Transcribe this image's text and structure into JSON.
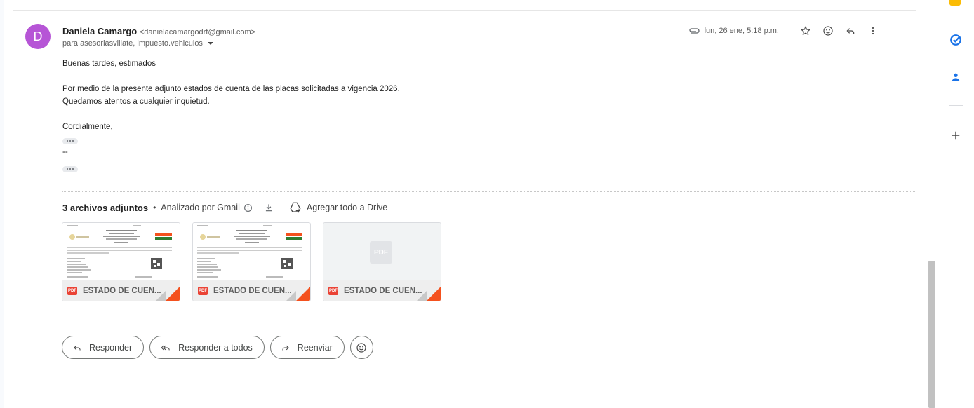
{
  "email": {
    "sender_initial": "D",
    "sender_name": "Daniela Camargo",
    "sender_email": "<danielacamargodrf@gmail.com>",
    "recipients": "para asesoriasvillate, impuesto.vehiculos",
    "date": "lun, 26 ene, 5:18 p.m.",
    "body": {
      "greeting": "Buenas tardes, estimados",
      "line1": "Por medio de la presente adjunto estados de cuenta de las placas solicitadas a vigencia 2026.",
      "line2": "Quedamos atentos a cualquier inquietud.",
      "closing": "Cordialmente,",
      "signature_sep": "--"
    }
  },
  "attachments": {
    "count_label": "3 archivos adjuntos",
    "separator": "•",
    "scanned_label": "Analizado por Gmail",
    "drive_label": "Agregar todo a Drive",
    "files": [
      {
        "name": "ESTADO DE CUEN...",
        "badge": "PDF",
        "preview": "document"
      },
      {
        "name": "ESTADO DE CUEN...",
        "badge": "PDF",
        "preview": "document"
      },
      {
        "name": "ESTADO DE CUEN...",
        "badge": "PDF",
        "preview": "PDF"
      }
    ]
  },
  "actions": {
    "reply": "Responder",
    "reply_all": "Responder a todos",
    "forward": "Reenviar"
  },
  "colors": {
    "avatar": "#b655d6",
    "pdf_red": "#ea4335",
    "corner_orange": "#f4511e",
    "tasks_blue": "#1a73e8",
    "keep_yellow": "#fbbc04"
  },
  "icons": [
    "paperclip-icon",
    "star-icon",
    "emoji-icon",
    "reply-icon",
    "more-vert-icon",
    "info-icon",
    "download-icon",
    "drive-add-icon",
    "tasks-icon",
    "contacts-icon",
    "add-icon",
    "reply-all-icon",
    "forward-icon"
  ]
}
